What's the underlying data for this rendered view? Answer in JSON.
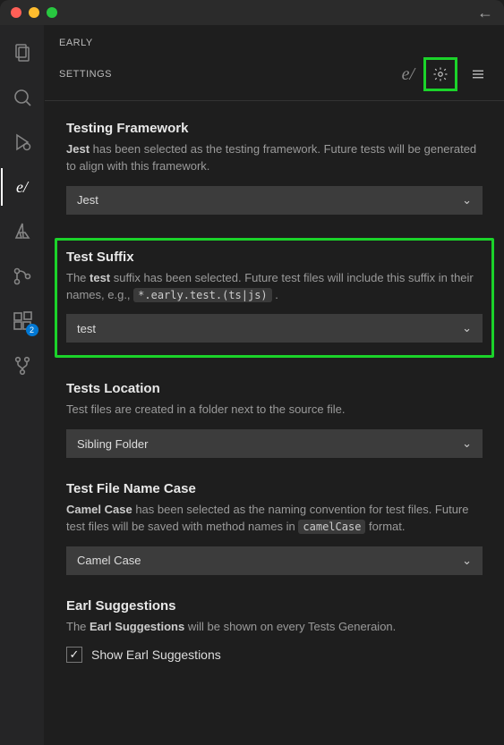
{
  "titlebar": {
    "back_aria": "←"
  },
  "activity": {
    "badge_ext": "2"
  },
  "header": {
    "app": "EARLY",
    "section": "SETTINGS",
    "brand": "e/"
  },
  "sections": {
    "framework": {
      "title": "Testing Framework",
      "desc_a": "Jest",
      "desc_b": " has been selected as the testing framework. Future tests will be generated to align with this framework.",
      "value": "Jest"
    },
    "suffix": {
      "title": "Test Suffix",
      "desc_a": "The ",
      "desc_b": "test",
      "desc_c": " suffix has been selected. Future test files will include this suffix in their names, e.g., ",
      "code": "*.early.test.(ts|js)",
      "desc_d": " .",
      "value": "test"
    },
    "location": {
      "title": "Tests Location",
      "desc": "Test files are created in a folder next to the source file.",
      "value": "Sibling Folder"
    },
    "case": {
      "title": "Test File Name Case",
      "desc_a": "Camel Case",
      "desc_b": " has been selected as the naming convention for test files. Future test files will be saved with method names in ",
      "code": "camelCase",
      "desc_c": " format.",
      "value": "Camel Case"
    },
    "suggestions": {
      "title": "Earl Suggestions",
      "desc_a": "The ",
      "desc_b": "Earl Suggestions",
      "desc_c": " will be shown on every Tests Generaion.",
      "checkbox_label": "Show Earl Suggestions",
      "checked": true
    }
  }
}
